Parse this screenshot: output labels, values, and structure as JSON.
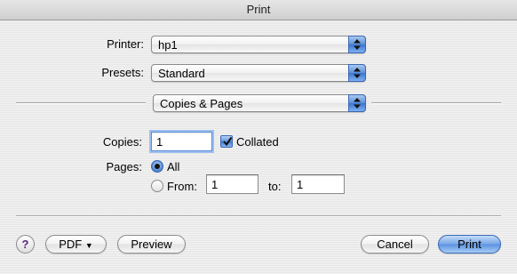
{
  "window": {
    "title": "Print"
  },
  "printer": {
    "label": "Printer:",
    "value": "hp1"
  },
  "presets": {
    "label": "Presets:",
    "value": "Standard"
  },
  "pane": {
    "value": "Copies & Pages"
  },
  "copies": {
    "label": "Copies:",
    "value": "1",
    "collated_label": "Collated",
    "collated_checked": true
  },
  "pages": {
    "label": "Pages:",
    "all_label": "All",
    "from_label": "From:",
    "from_value": "1",
    "to_label": "to:",
    "to_value": "1",
    "selected": "All"
  },
  "footer": {
    "help_label": "?",
    "pdf_label": "PDF",
    "pdf_arrow": "▼",
    "preview_label": "Preview",
    "cancel_label": "Cancel",
    "print_label": "Print"
  },
  "colors": {
    "accent": "#4a82d6",
    "help_icon": "#5b2a86"
  }
}
